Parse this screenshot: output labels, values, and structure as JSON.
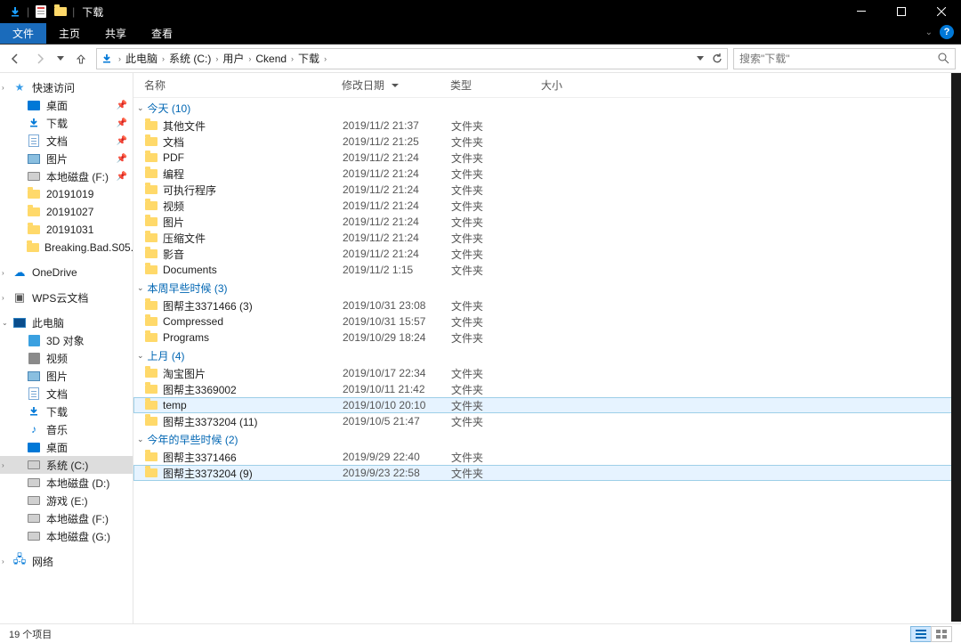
{
  "window": {
    "title": "下载"
  },
  "ribbon": {
    "tabs": [
      "文件",
      "主页",
      "共享",
      "查看"
    ],
    "active": 0
  },
  "breadcrumb": [
    "此电脑",
    "系统 (C:)",
    "用户",
    "Ckend",
    "下载"
  ],
  "search": {
    "placeholder": "搜索\"下载\""
  },
  "columns": {
    "name": "名称",
    "date": "修改日期",
    "type": "类型",
    "size": "大小"
  },
  "sidebar": {
    "quick": "快速访问",
    "items_pinned": [
      {
        "label": "桌面",
        "icon": "desktop"
      },
      {
        "label": "下载",
        "icon": "download"
      },
      {
        "label": "文档",
        "icon": "doc"
      },
      {
        "label": "图片",
        "icon": "pic"
      },
      {
        "label": "本地磁盘 (F:)",
        "icon": "drive"
      }
    ],
    "items_recent": [
      {
        "label": "20191019"
      },
      {
        "label": "20191027"
      },
      {
        "label": "20191031"
      },
      {
        "label": "Breaking.Bad.S05."
      }
    ],
    "onedrive": "OneDrive",
    "wps": "WPS云文档",
    "thispc": "此电脑",
    "pc_items": [
      {
        "label": "3D 对象",
        "icon": "3d"
      },
      {
        "label": "视频",
        "icon": "vid"
      },
      {
        "label": "图片",
        "icon": "pic"
      },
      {
        "label": "文档",
        "icon": "doc"
      },
      {
        "label": "下载",
        "icon": "download"
      },
      {
        "label": "音乐",
        "icon": "music"
      },
      {
        "label": "桌面",
        "icon": "desktop"
      },
      {
        "label": "系统 (C:)",
        "icon": "drive",
        "selected": true
      },
      {
        "label": "本地磁盘 (D:)",
        "icon": "drive"
      },
      {
        "label": "游戏 (E:)",
        "icon": "drive"
      },
      {
        "label": "本地磁盘 (F:)",
        "icon": "drive"
      },
      {
        "label": "本地磁盘 (G:)",
        "icon": "drive"
      }
    ],
    "network": "网络"
  },
  "groups": [
    {
      "title": "今天 (10)",
      "rows": [
        {
          "name": "其他文件",
          "date": "2019/11/2 21:37",
          "type": "文件夹"
        },
        {
          "name": "文档",
          "date": "2019/11/2 21:25",
          "type": "文件夹"
        },
        {
          "name": "PDF",
          "date": "2019/11/2 21:24",
          "type": "文件夹"
        },
        {
          "name": "编程",
          "date": "2019/11/2 21:24",
          "type": "文件夹"
        },
        {
          "name": "可执行程序",
          "date": "2019/11/2 21:24",
          "type": "文件夹"
        },
        {
          "name": "视频",
          "date": "2019/11/2 21:24",
          "type": "文件夹"
        },
        {
          "name": "图片",
          "date": "2019/11/2 21:24",
          "type": "文件夹"
        },
        {
          "name": "压缩文件",
          "date": "2019/11/2 21:24",
          "type": "文件夹"
        },
        {
          "name": "影音",
          "date": "2019/11/2 21:24",
          "type": "文件夹"
        },
        {
          "name": "Documents",
          "date": "2019/11/2 1:15",
          "type": "文件夹"
        }
      ]
    },
    {
      "title": "本周早些时候 (3)",
      "rows": [
        {
          "name": "图帮主3371466 (3)",
          "date": "2019/10/31 23:08",
          "type": "文件夹"
        },
        {
          "name": "Compressed",
          "date": "2019/10/31 15:57",
          "type": "文件夹"
        },
        {
          "name": "Programs",
          "date": "2019/10/29 18:24",
          "type": "文件夹"
        }
      ]
    },
    {
      "title": "上月 (4)",
      "rows": [
        {
          "name": "淘宝图片",
          "date": "2019/10/17 22:34",
          "type": "文件夹"
        },
        {
          "name": "图帮主3369002",
          "date": "2019/10/11 21:42",
          "type": "文件夹"
        },
        {
          "name": "temp",
          "date": "2019/10/10 20:10",
          "type": "文件夹",
          "hover": true
        },
        {
          "name": "图帮主3373204 (11)",
          "date": "2019/10/5 21:47",
          "type": "文件夹"
        }
      ]
    },
    {
      "title": "今年的早些时候 (2)",
      "rows": [
        {
          "name": "图帮主3371466",
          "date": "2019/9/29 22:40",
          "type": "文件夹"
        },
        {
          "name": "图帮主3373204 (9)",
          "date": "2019/9/23 22:58",
          "type": "文件夹",
          "hover": true
        }
      ]
    }
  ],
  "status": {
    "count": "19 个项目"
  }
}
